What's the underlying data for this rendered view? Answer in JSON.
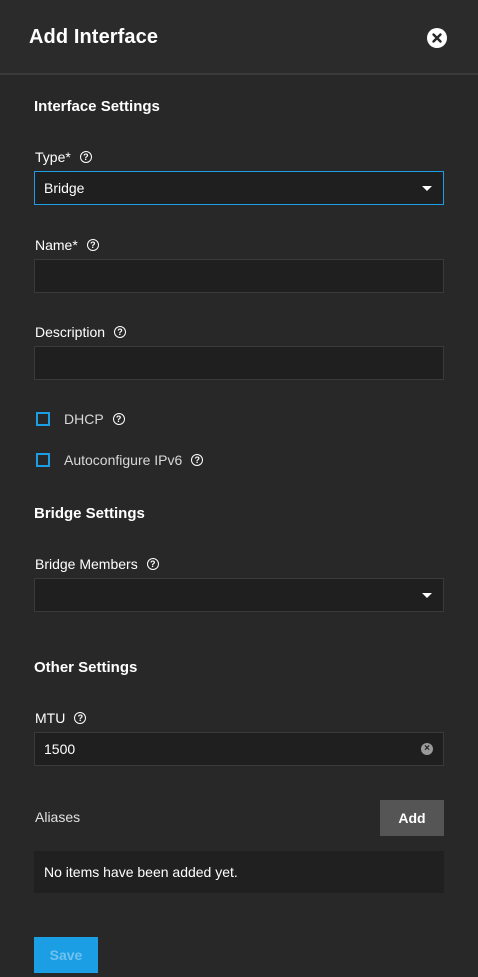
{
  "header": {
    "title": "Add Interface",
    "close_icon": "close-icon"
  },
  "interface_settings": {
    "section_title": "Interface Settings",
    "type": {
      "label": "Type",
      "required": "*",
      "value": "Bridge"
    },
    "name": {
      "label": "Name",
      "required": "*",
      "value": ""
    },
    "description": {
      "label": "Description",
      "value": ""
    },
    "dhcp": {
      "label": "DHCP",
      "checked": false
    },
    "ipv6": {
      "label": "Autoconfigure IPv6",
      "checked": false
    }
  },
  "bridge_settings": {
    "section_title": "Bridge Settings",
    "members": {
      "label": "Bridge Members",
      "value": ""
    }
  },
  "other_settings": {
    "section_title": "Other Settings",
    "mtu": {
      "label": "MTU",
      "value": "1500"
    }
  },
  "aliases": {
    "label": "Aliases",
    "add_label": "Add",
    "empty_text": "No items have been added yet."
  },
  "actions": {
    "save_label": "Save"
  },
  "colors": {
    "accent": "#1b9ee4",
    "background": "#282828",
    "field": "#1f1f1f"
  }
}
